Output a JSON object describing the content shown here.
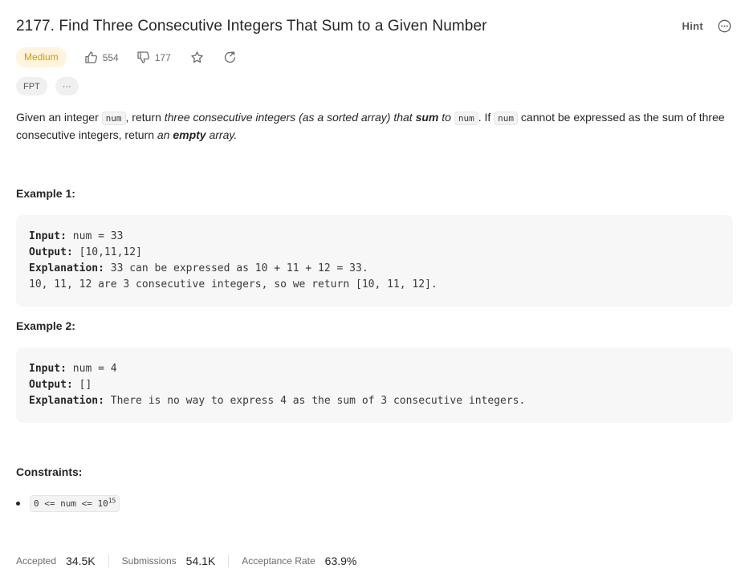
{
  "problem": {
    "title": "2177. Find Three Consecutive Integers That Sum to a Given Number",
    "difficulty": "Medium",
    "likes": "554",
    "dislikes": "177",
    "hint_label": "Hint",
    "tags": [
      "FPT",
      "···"
    ]
  },
  "description": {
    "p1": "Given an integer ",
    "code1": "num",
    "p2": ", return ",
    "em1": "three consecutive integers (as a sorted array) that ",
    "strong1": "sum",
    "em2": " to ",
    "code2": "num",
    "p3": ". If ",
    "code3": "num",
    "p4": " cannot be expressed as the sum of three consecutive integers, return ",
    "em3": "an ",
    "strong2": "empty",
    "em4": " array."
  },
  "examples": [
    {
      "title": "Example 1:",
      "input_label": "Input:",
      "input": " num = 33",
      "output_label": "Output:",
      "output": " [10,11,12]",
      "explanation_label": "Explanation:",
      "explanation": " 33 can be expressed as 10 + 11 + 12 = 33.",
      "explanation2": "10, 11, 12 are 3 consecutive integers, so we return [10, 11, 12]."
    },
    {
      "title": "Example 2:",
      "input_label": "Input:",
      "input": " num = 4",
      "output_label": "Output:",
      "output": " []",
      "explanation_label": "Explanation:",
      "explanation": " There is no way to express 4 as the sum of 3 consecutive integers."
    }
  ],
  "constraints": {
    "title": "Constraints:",
    "c1_code": "0 <= num <= 10",
    "c1_sup": "15"
  },
  "stats": {
    "accepted_label": "Accepted",
    "accepted": "34.5K",
    "submissions_label": "Submissions",
    "submissions": "54.1K",
    "rate_label": "Acceptance Rate",
    "rate": "63.9%"
  },
  "colors": {
    "difficulty_medium": "#d59a00",
    "difficulty_bg": "#fff4dd",
    "code_bg": "#f7f7f8"
  }
}
